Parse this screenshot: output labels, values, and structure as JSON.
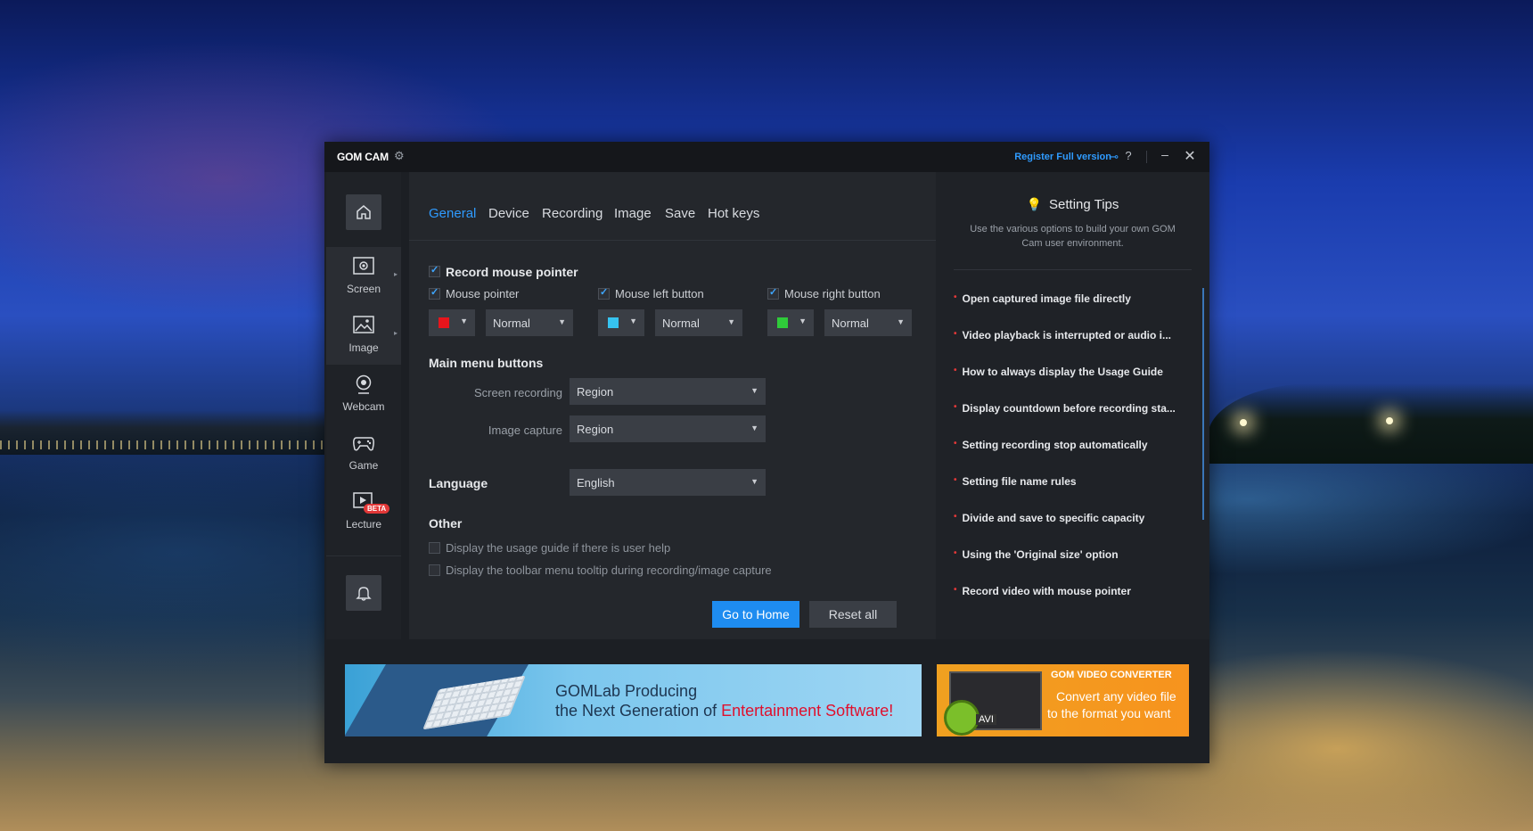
{
  "window": {
    "title": "GOM CAM",
    "register": "Register Full version",
    "help": "?",
    "minimize": "–",
    "close": "✕"
  },
  "nav": {
    "items": [
      {
        "label": "Screen"
      },
      {
        "label": "Image"
      },
      {
        "label": "Webcam"
      },
      {
        "label": "Game"
      },
      {
        "label": "Lecture",
        "badge": "BETA"
      }
    ]
  },
  "tabs": [
    "General",
    "Device",
    "Recording",
    "Image",
    "Save",
    "Hot keys"
  ],
  "mouse": {
    "record_label": "Record mouse pointer",
    "pointer": {
      "label": "Mouse pointer",
      "color": "#e8151c",
      "size": "Normal"
    },
    "left": {
      "label": "Mouse left button",
      "color": "#36c3f0",
      "size": "Normal"
    },
    "right": {
      "label": "Mouse right button",
      "color": "#2fcb3a",
      "size": "Normal"
    }
  },
  "main_menu": {
    "title": "Main menu buttons",
    "screen_label": "Screen recording",
    "screen_value": "Region",
    "image_label": "Image capture",
    "image_value": "Region"
  },
  "language": {
    "title": "Language",
    "value": "English"
  },
  "other": {
    "title": "Other",
    "opt1": "Display the usage guide if there is user help",
    "opt2": "Display the toolbar menu tooltip during recording/image capture"
  },
  "buttons": {
    "home": "Go to Home",
    "reset": "Reset all"
  },
  "tips": {
    "title": "Setting Tips",
    "desc": "Use the various options to build your own GOM Cam user environment.",
    "items": [
      "Open captured image file directly",
      "Video playback is interrupted or audio i...",
      "How to always display the Usage Guide",
      "Display countdown before recording sta...",
      "Setting recording stop automatically",
      "Setting file name rules",
      "Divide and save to specific capacity",
      "Using the 'Original size' option",
      "Record video with mouse pointer"
    ]
  },
  "banners": {
    "left_line1": "GOMLab Producing",
    "left_line2_prefix": "the Next Generation of ",
    "left_line2_highlight": "Entertainment Software!",
    "right_title": "GOM VIDEO CONVERTER",
    "right_line1": "Convert any video file",
    "right_line2": "to the format you want",
    "right_badge": "AVI"
  }
}
